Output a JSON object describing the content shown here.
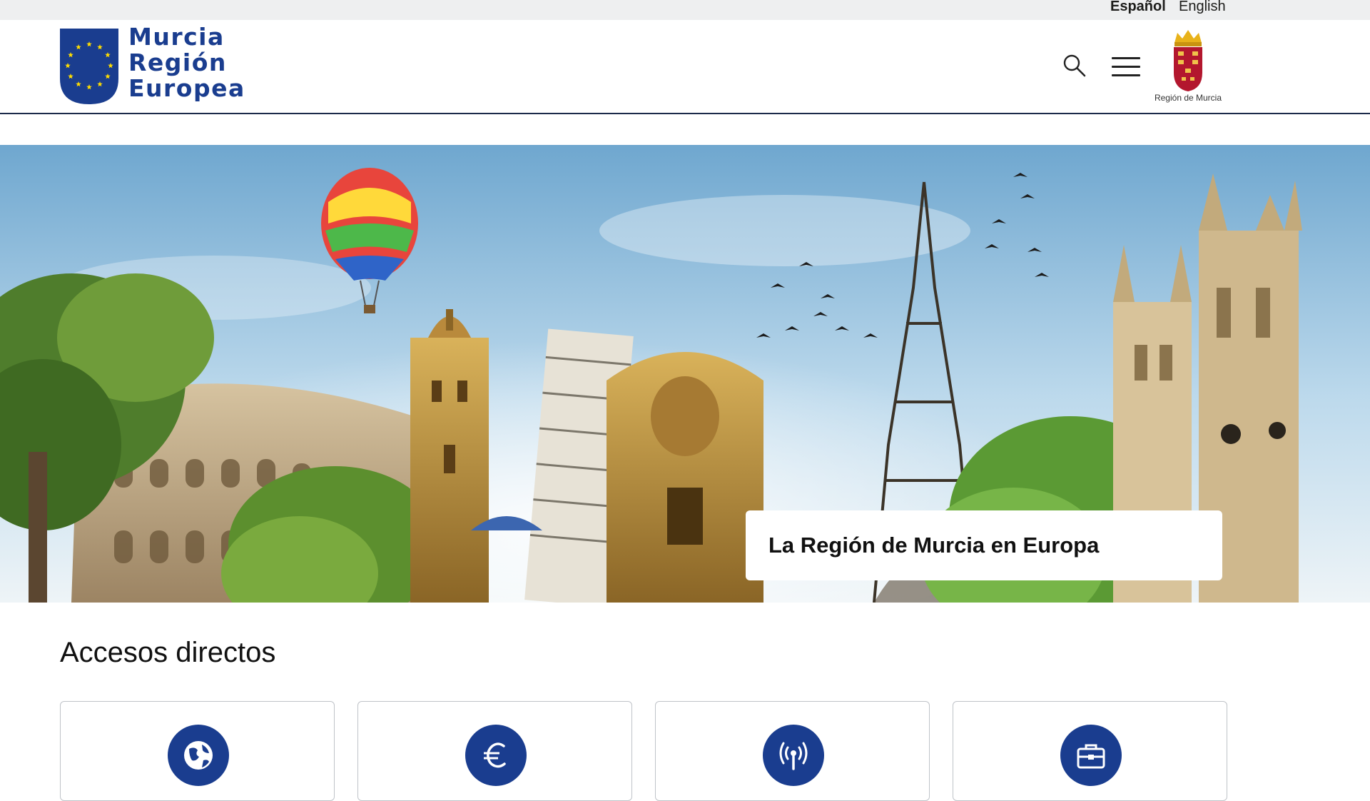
{
  "languages": {
    "es": "Español",
    "en": "English"
  },
  "header": {
    "logo": {
      "line1": "Murcia",
      "line2": "Región",
      "line3": "Europea"
    },
    "region_logo_text": "Región de Murcia",
    "icons": {
      "search": "search-icon",
      "menu": "hamburger-menu-icon"
    }
  },
  "hero": {
    "caption": "La Región de Murcia en Europa"
  },
  "accesos": {
    "title": "Accesos directos",
    "cards": [
      {
        "icon": "globe-icon"
      },
      {
        "icon": "euro-icon"
      },
      {
        "icon": "antenna-icon"
      },
      {
        "icon": "briefcase-icon"
      }
    ]
  },
  "colors": {
    "brand_blue": "#1a3d8f",
    "eu_star_yellow": "#ffdd00",
    "region_red": "#b3172e"
  }
}
